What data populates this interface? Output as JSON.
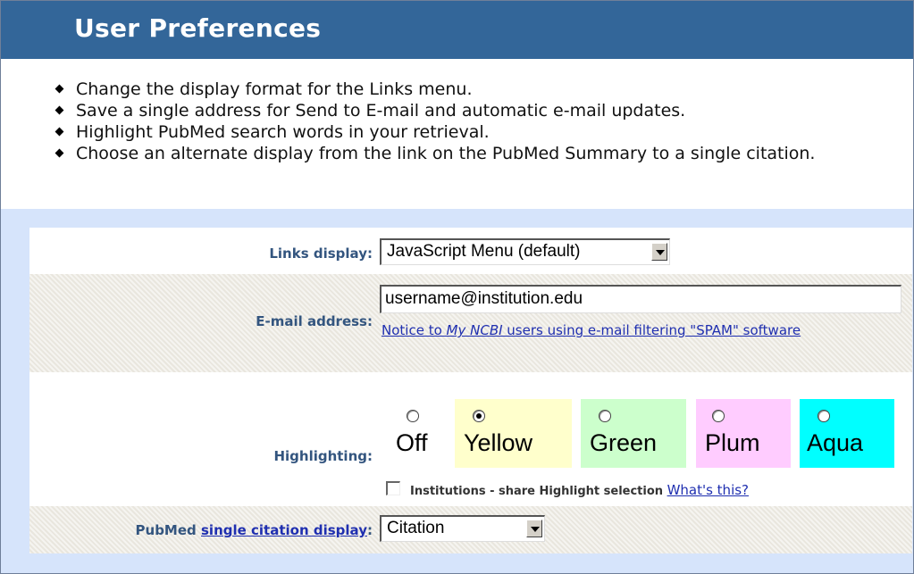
{
  "header": {
    "title": "User Preferences"
  },
  "intro": {
    "bullets": [
      "Change the display format for the Links menu.",
      "Save a single address for Send to E-mail and automatic e-mail updates.",
      "Highlight PubMed search words in your retrieval.",
      "Choose an alternate display from the link on the PubMed Summary to a single citation."
    ]
  },
  "links_display": {
    "label": "Links display:",
    "selected": "JavaScript Menu (default)"
  },
  "email": {
    "label": "E-mail address:",
    "value": "username@institution.edu",
    "notice_prefix": "Notice to ",
    "notice_italic": "My NCBI",
    "notice_suffix": " users using e-mail filtering \"SPAM\" software"
  },
  "highlighting": {
    "label": "Highlighting:",
    "options": [
      {
        "label": "Off",
        "selected": false,
        "color": "#ffffff"
      },
      {
        "label": "Yellow",
        "selected": true,
        "color": "#ffffcc"
      },
      {
        "label": "Green",
        "selected": false,
        "color": "#ccffcc"
      },
      {
        "label": "Plum",
        "selected": false,
        "color": "#ffccff"
      },
      {
        "label": "Aqua",
        "selected": false,
        "color": "#00ffff"
      }
    ],
    "institutions_label": "Institutions - share Highlight selection",
    "whats_this": "What's this?"
  },
  "citation_display": {
    "label_prefix": "PubMed ",
    "label_link": "single citation display",
    "label_suffix": ":",
    "selected": "Citation"
  }
}
